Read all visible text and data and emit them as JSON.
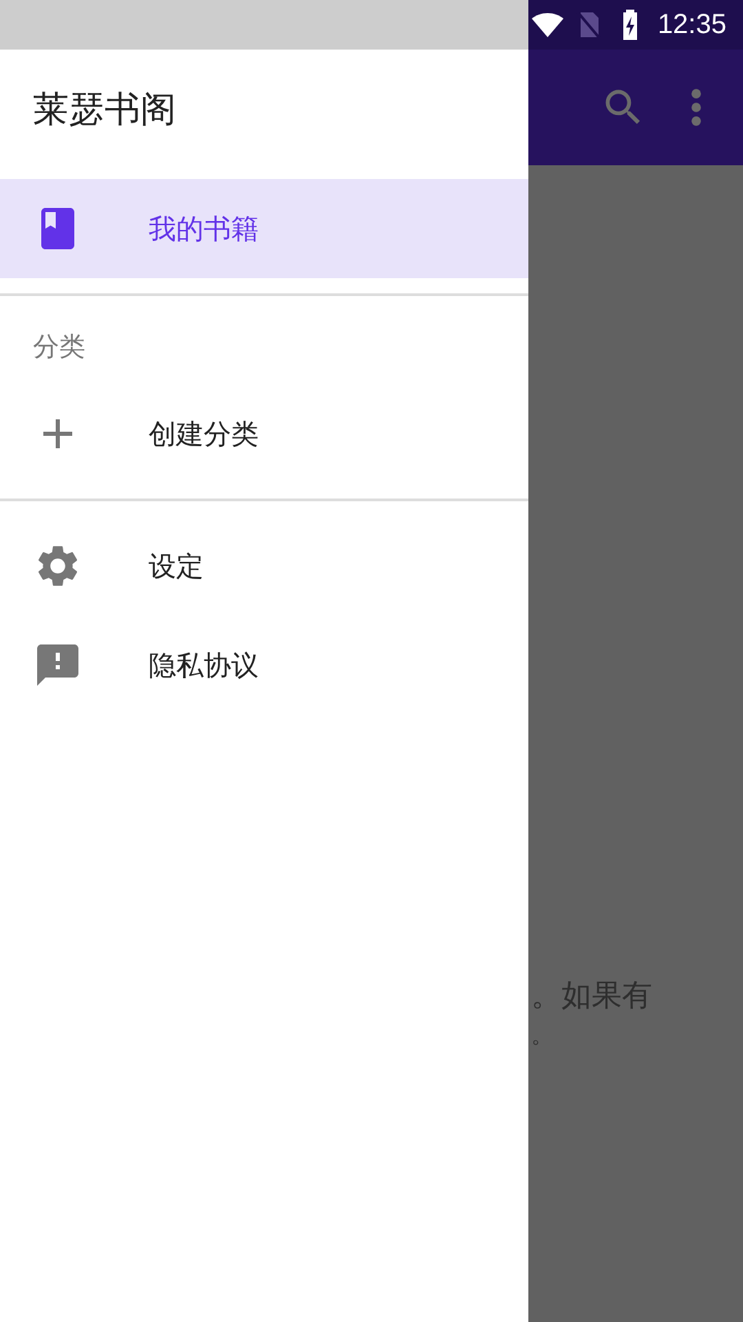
{
  "status_bar": {
    "time": "12:35"
  },
  "drawer": {
    "title": "莱瑟书阁",
    "groups": [
      {
        "items": [
          {
            "label": "我的书籍",
            "selected": true
          }
        ]
      },
      {
        "subheader": "分类",
        "items": [
          {
            "label": "创建分类",
            "selected": false
          }
        ]
      },
      {
        "items": [
          {
            "label": "设定",
            "selected": false
          },
          {
            "label": "隐私协议",
            "selected": false
          }
        ]
      }
    ]
  },
  "background": {
    "lines": [
      "。如果有",
      "。"
    ]
  }
}
